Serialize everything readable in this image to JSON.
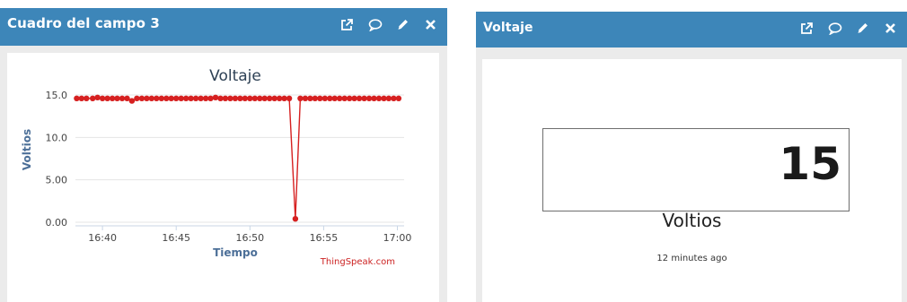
{
  "panels": [
    {
      "title": "Cuadro del campo 3",
      "tools": [
        "external-link-icon",
        "comment-icon",
        "pencil-icon",
        "close-icon"
      ]
    },
    {
      "title": "Voltaje",
      "tools": [
        "external-link-icon",
        "comment-icon",
        "pencil-icon",
        "close-icon"
      ],
      "value": "15",
      "units": "Voltios",
      "updated": "12 minutes ago"
    }
  ],
  "chart_data": {
    "type": "line",
    "title": "Voltaje",
    "xlabel": "Tiempo",
    "ylabel": "Voltios",
    "credit": "ThingSpeak.com",
    "yticks": [
      "0.00",
      "5.00",
      "10.0",
      "15.0"
    ],
    "ylim": [
      0,
      15
    ],
    "xticks": [
      "16:40",
      "16:45",
      "16:50",
      "16:55",
      "17:00"
    ],
    "xlim": [
      "16:38:10",
      "17:00:20"
    ],
    "grid": true,
    "legend": "none",
    "color": "#d62020",
    "series": [
      {
        "x": [
          "16:38:15",
          "16:38:35",
          "16:38:55",
          "16:39:20",
          "16:39:40",
          "16:40:00",
          "16:40:20",
          "16:40:40",
          "16:41:00",
          "16:41:20",
          "16:41:40",
          "16:42:00",
          "16:42:20",
          "16:42:40",
          "16:43:00",
          "16:43:20",
          "16:43:40",
          "16:44:00",
          "16:44:20",
          "16:44:40",
          "16:45:00",
          "16:45:20",
          "16:45:40",
          "16:46:00",
          "16:46:20",
          "16:46:40",
          "16:47:00",
          "16:47:20",
          "16:47:40",
          "16:48:00",
          "16:48:20",
          "16:48:40",
          "16:49:00",
          "16:49:20",
          "16:49:40",
          "16:50:00",
          "16:50:20",
          "16:50:40",
          "16:51:00",
          "16:51:20",
          "16:51:40",
          "16:52:00",
          "16:52:20",
          "16:52:40",
          "16:53:05",
          "16:53:25",
          "16:53:45",
          "16:54:05",
          "16:54:25",
          "16:54:45",
          "16:55:05",
          "16:55:25",
          "16:55:45",
          "16:56:05",
          "16:56:25",
          "16:56:45",
          "16:57:05",
          "16:57:25",
          "16:57:45",
          "16:58:05",
          "16:58:25",
          "16:58:45",
          "16:59:05",
          "16:59:25",
          "16:59:45",
          "17:00:05"
        ],
        "y": [
          14.6,
          14.6,
          14.6,
          14.6,
          14.7,
          14.6,
          14.6,
          14.6,
          14.6,
          14.6,
          14.6,
          14.3,
          14.6,
          14.6,
          14.6,
          14.6,
          14.6,
          14.6,
          14.6,
          14.6,
          14.6,
          14.6,
          14.6,
          14.6,
          14.6,
          14.6,
          14.6,
          14.6,
          14.7,
          14.6,
          14.6,
          14.6,
          14.6,
          14.6,
          14.6,
          14.6,
          14.6,
          14.6,
          14.6,
          14.6,
          14.6,
          14.6,
          14.6,
          14.6,
          0.4,
          14.6,
          14.6,
          14.6,
          14.6,
          14.6,
          14.6,
          14.6,
          14.6,
          14.6,
          14.6,
          14.6,
          14.6,
          14.6,
          14.6,
          14.6,
          14.6,
          14.6,
          14.6,
          14.6,
          14.6,
          14.6
        ]
      }
    ]
  }
}
